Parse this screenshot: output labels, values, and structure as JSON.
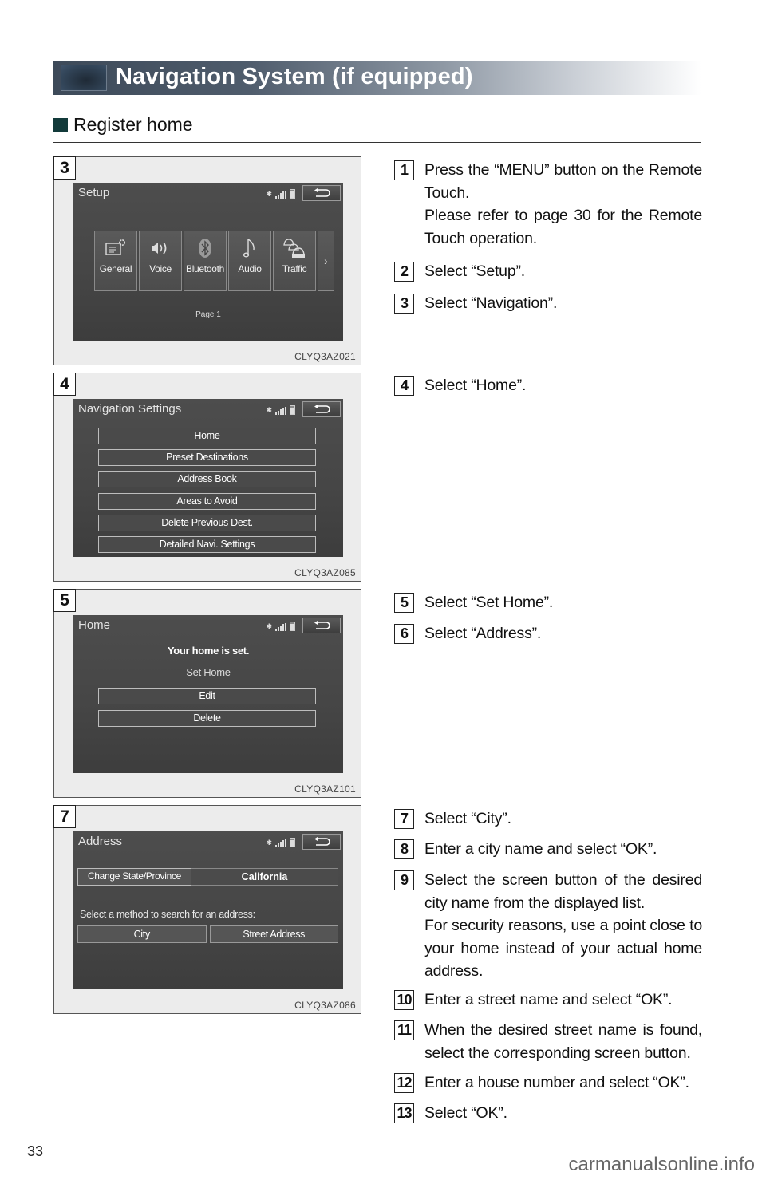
{
  "header": {
    "title": "Navigation System (if equipped)"
  },
  "section": {
    "title": "Register home"
  },
  "figures": [
    {
      "number": "3",
      "code": "CLYQ3AZ021",
      "screen_title": "Setup",
      "tiles": [
        {
          "label": "General",
          "icon": "general-settings-icon"
        },
        {
          "label": "Voice",
          "icon": "speaker-icon"
        },
        {
          "label": "Bluetooth",
          "icon": "bluetooth-icon"
        },
        {
          "label": "Audio",
          "icon": "music-note-icon"
        },
        {
          "label": "Traffic",
          "icon": "traffic-cars-icon"
        }
      ],
      "more_arrow": "›",
      "page_label": "Page 1"
    },
    {
      "number": "4",
      "code": "CLYQ3AZ085",
      "screen_title": "Navigation Settings",
      "buttons": [
        "Home",
        "Preset Destinations",
        "Address Book",
        "Areas to Avoid",
        "Delete Previous Dest.",
        "Detailed Navi. Settings"
      ]
    },
    {
      "number": "5",
      "code": "CLYQ3AZ101",
      "screen_title": "Home",
      "message": "Your home is set.",
      "subtitle": "Set Home",
      "buttons": [
        "Edit",
        "Delete"
      ]
    },
    {
      "number": "7",
      "code": "CLYQ3AZ086",
      "screen_title": "Address",
      "change_state_label": "Change State/Province",
      "state_value": "California",
      "prompt": "Select a method to search for an address:",
      "methods": [
        "City",
        "Street Address"
      ]
    }
  ],
  "steps": [
    {
      "num": "1",
      "text": "Press the “MENU” button on the Remote Touch.",
      "note": "Please refer to page 30 for the Remote Touch operation."
    },
    {
      "num": "2",
      "text": "Select “Setup”."
    },
    {
      "num": "3",
      "text": "Select “Navigation”."
    },
    {
      "num": "4",
      "text": "Select “Home”."
    },
    {
      "num": "5",
      "text": "Select “Set Home”."
    },
    {
      "num": "6",
      "text": "Select “Address”."
    },
    {
      "num": "7",
      "text": "Select “City”."
    },
    {
      "num": "8",
      "text": "Enter a city name and select “OK”."
    },
    {
      "num": "9",
      "text": "Select the screen button of the desired city name from the displayed list.",
      "note": "For security reasons, use a point close to your home instead of your actual home address."
    },
    {
      "num": "10",
      "text": "Enter a street name and select “OK”."
    },
    {
      "num": "11",
      "text": "When the desired street name is found, select the corresponding screen button."
    },
    {
      "num": "12",
      "text": "Enter a house number and select “OK”."
    },
    {
      "num": "13",
      "text": "Select “OK”."
    }
  ],
  "footer": {
    "page_number": "33",
    "watermark": "carmanualsonline.info"
  }
}
